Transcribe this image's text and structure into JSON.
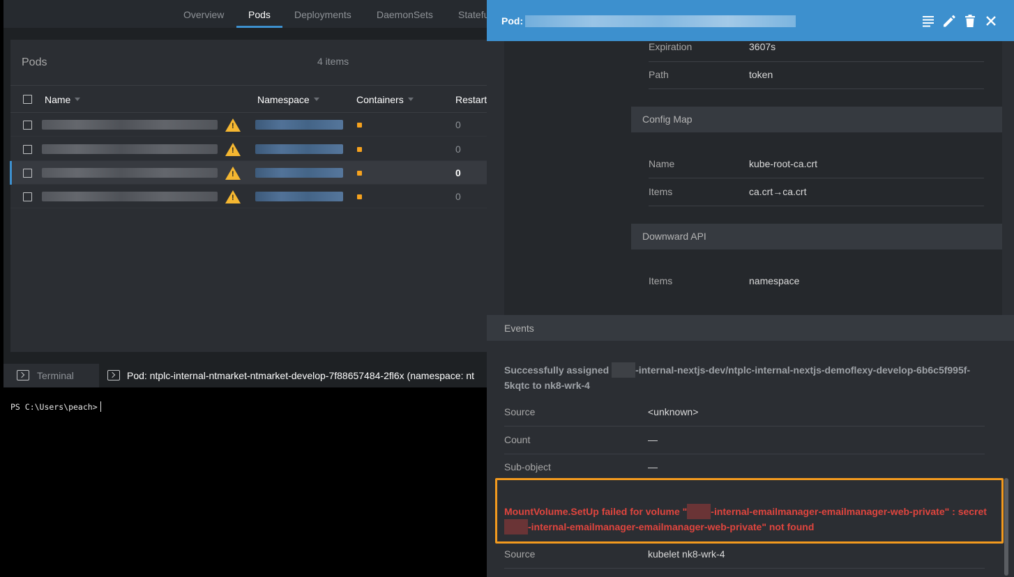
{
  "tabs": [
    "Overview",
    "Pods",
    "Deployments",
    "DaemonSets",
    "Statefu"
  ],
  "active_tab": "Pods",
  "pods": {
    "title": "Pods",
    "count": "4 items",
    "columns": [
      "Name",
      "Namespace",
      "Containers",
      "Restart"
    ],
    "rows": [
      {
        "restarts": "0"
      },
      {
        "restarts": "0"
      },
      {
        "restarts": "0"
      },
      {
        "restarts": "0"
      }
    ]
  },
  "dock": {
    "terminal_label": "Terminal",
    "pod_tab_label": "Pod: ntplc-internal-ntmarket-ntmarket-develop-7f88657484-2fl6x (namespace: nt"
  },
  "terminal": {
    "prompt": "PS C:\\Users\\peach>"
  },
  "drawer": {
    "title_prefix": "Pod:",
    "token": [
      {
        "label": "Expiration",
        "value": "3607s"
      },
      {
        "label": "Path",
        "value": "token"
      }
    ],
    "config_map": {
      "heading": "Config Map",
      "fields": [
        {
          "label": "Name",
          "value": "kube-root-ca.crt"
        },
        {
          "label": "Items",
          "value": "ca.crt→ca.crt"
        }
      ]
    },
    "downward_api": {
      "heading": "Downward API",
      "fields": [
        {
          "label": "Items",
          "value": "namespace"
        }
      ]
    },
    "events": {
      "heading": "Events",
      "event1": {
        "msg_before": "Successfully assigned",
        "msg_after": "-internal-nextjs-dev/ntplc-internal-nextjs-demoflexy-develop-6b6c5f995f-5kqtc to nk8-wrk-4",
        "fields": [
          {
            "label": "Source",
            "value": "<unknown>"
          },
          {
            "label": "Count",
            "value": "—"
          },
          {
            "label": "Sub-object",
            "value": "—"
          }
        ]
      },
      "event2": {
        "msg_part1": "MountVolume.SetUp failed for volume \"",
        "msg_part2": "-internal-emailmanager-emailmanager-web-private\" : secret",
        "msg_part3": "-internal-emailmanager-emailmanager-web-private\" not found",
        "fields": [
          {
            "label": "Source",
            "value": "kubelet nk8-wrk-4"
          }
        ]
      }
    }
  },
  "colors": {
    "accent": "#3d90ce",
    "warning": "#f5b731",
    "error": "#e0453e",
    "highlight": "#f39a1e"
  }
}
